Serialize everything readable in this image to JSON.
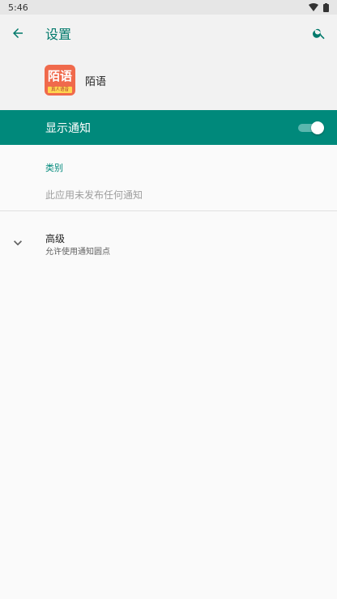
{
  "status_bar": {
    "time": "5:46"
  },
  "app_bar": {
    "title": "设置"
  },
  "app": {
    "name": "陌语",
    "icon_text": "陌语",
    "icon_subtext": "真人语音"
  },
  "master_switch": {
    "label": "显示通知",
    "state": "on"
  },
  "category": {
    "title": "类别",
    "empty_text": "此应用未发布任何通知"
  },
  "advanced": {
    "title": "高级",
    "subtitle": "允许使用通知圆点"
  },
  "colors": {
    "accent": "#00897b",
    "title": "#00796b"
  }
}
